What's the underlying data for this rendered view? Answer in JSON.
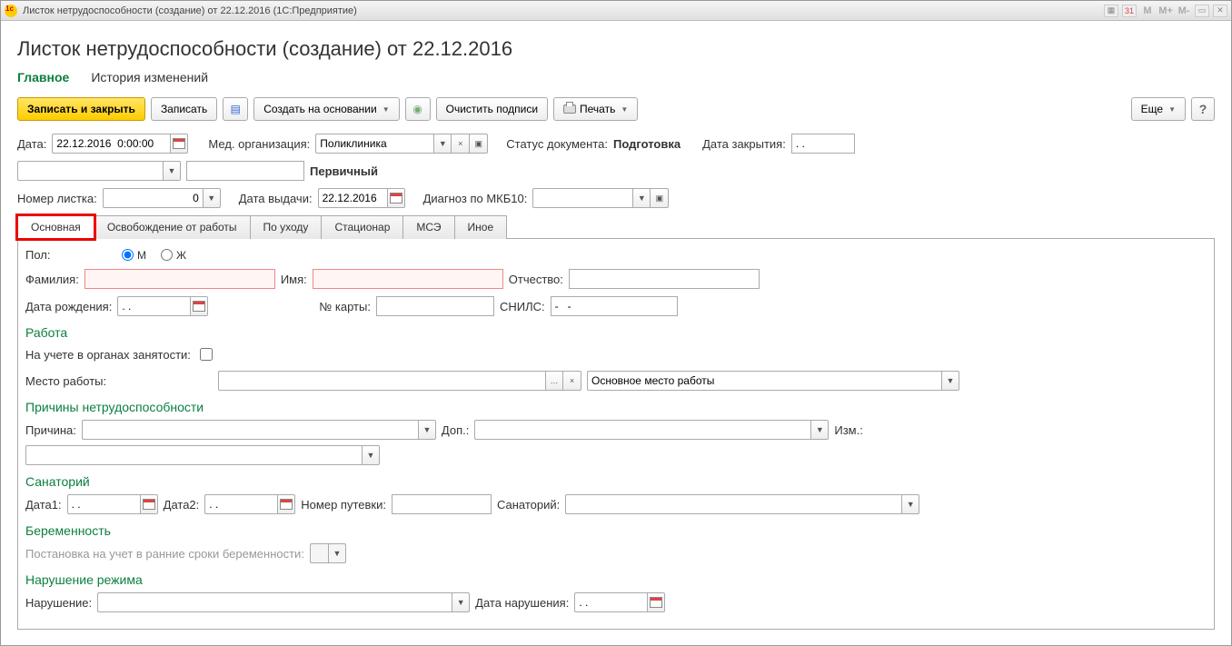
{
  "window": {
    "title": "Листок нетрудоспособности (создание) от 22.12.2016  (1С:Предприятие)"
  },
  "page": {
    "title": "Листок нетрудоспособности (создание) от 22.12.2016"
  },
  "nav": {
    "main": "Главное",
    "history": "История изменений"
  },
  "toolbar": {
    "save_close": "Записать и закрыть",
    "save": "Записать",
    "create_based": "Создать на основании",
    "clear_sign": "Очистить подписи",
    "print": "Печать",
    "more": "Еще"
  },
  "fields": {
    "date_lbl": "Дата:",
    "date_val": "22.12.2016  0:00:00",
    "med_org_lbl": "Мед. организация:",
    "med_org_val": "Поликлиника",
    "status_lbl": "Статус документа:",
    "status_val": "Подготовка",
    "close_date_lbl": "Дата закрытия:",
    "close_date_val": ". .",
    "primary": "Первичный",
    "sheet_num_lbl": "Номер листка:",
    "sheet_num_val": "0",
    "issue_date_lbl": "Дата выдачи:",
    "issue_date_val": "22.12.2016",
    "diag_lbl": "Диагноз по МКБ10:"
  },
  "tabs": {
    "main": "Основная",
    "release": "Освобождение от работы",
    "care": "По уходу",
    "hospital": "Стационар",
    "mse": "МСЭ",
    "other": "Иное"
  },
  "main_tab": {
    "sex_lbl": "Пол:",
    "sex_m": "М",
    "sex_f": "Ж",
    "lastname_lbl": "Фамилия:",
    "firstname_lbl": "Имя:",
    "patronymic_lbl": "Отчество:",
    "birth_lbl": "Дата рождения:",
    "birth_val": ". .",
    "card_lbl": "№ карты:",
    "snils_lbl": "СНИЛС:",
    "snils_val": "-   -",
    "section_work": "Работа",
    "employment_lbl": "На учете в органах занятости:",
    "workplace_lbl": "Место работы:",
    "workplace_type": "Основное место работы",
    "section_reasons": "Причины нетрудоспособности",
    "reason_lbl": "Причина:",
    "dop_lbl": "Доп.:",
    "izm_lbl": "Изм.:",
    "section_sanatorium": "Санаторий",
    "date1_lbl": "Дата1:",
    "date1_val": ". .",
    "date2_lbl": "Дата2:",
    "date2_val": ". .",
    "voucher_lbl": "Номер путевки:",
    "sanatorium_lbl": "Санаторий:",
    "section_pregnancy": "Беременность",
    "pregnancy_reg_lbl": "Постановка на учет в ранние сроки беременности:",
    "section_violation": "Нарушение режима",
    "violation_lbl": "Нарушение:",
    "violation_date_lbl": "Дата нарушения:",
    "violation_date_val": ". ."
  }
}
